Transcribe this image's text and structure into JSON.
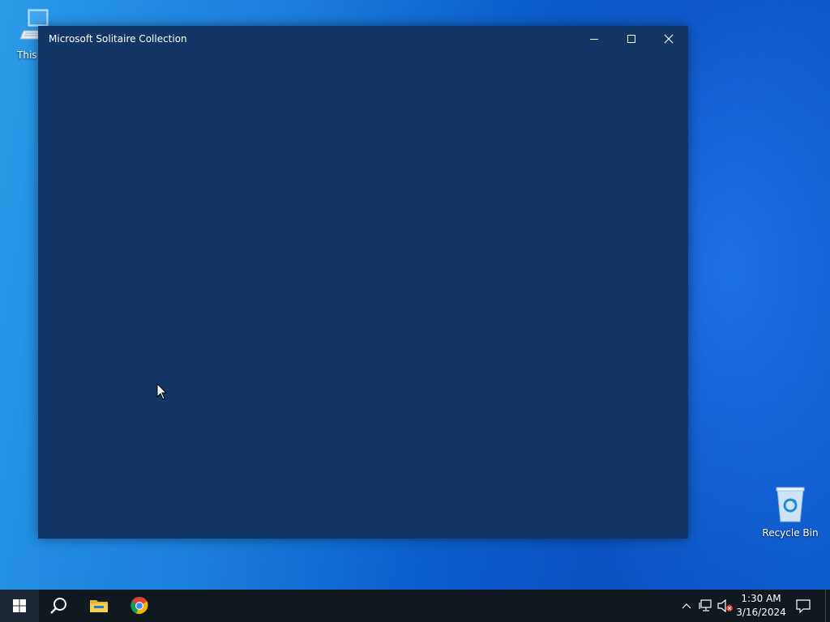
{
  "desktop": {
    "icons": [
      {
        "label": "This PC",
        "icon": "computer-icon"
      },
      {
        "label": "Recycle Bin",
        "icon": "recycle-bin-icon"
      }
    ]
  },
  "window": {
    "title": "Microsoft Solitaire Collection",
    "background_color": "#123767",
    "controls": {
      "minimize": "minimize-icon",
      "maximize": "maximize-icon",
      "close": "close-icon"
    }
  },
  "taskbar": {
    "items": [
      {
        "name": "Start",
        "icon": "windows-logo-icon"
      },
      {
        "name": "Search",
        "icon": "search-icon"
      },
      {
        "name": "File Explorer",
        "icon": "folder-icon"
      },
      {
        "name": "Google Chrome",
        "icon": "chrome-icon"
      }
    ],
    "tray": {
      "icons": [
        "chevron-up-icon",
        "network-icon",
        "volume-muted-icon",
        "notification-icon"
      ],
      "time": "1:30 AM",
      "date": "3/16/2024"
    },
    "background_color": "#101820"
  }
}
